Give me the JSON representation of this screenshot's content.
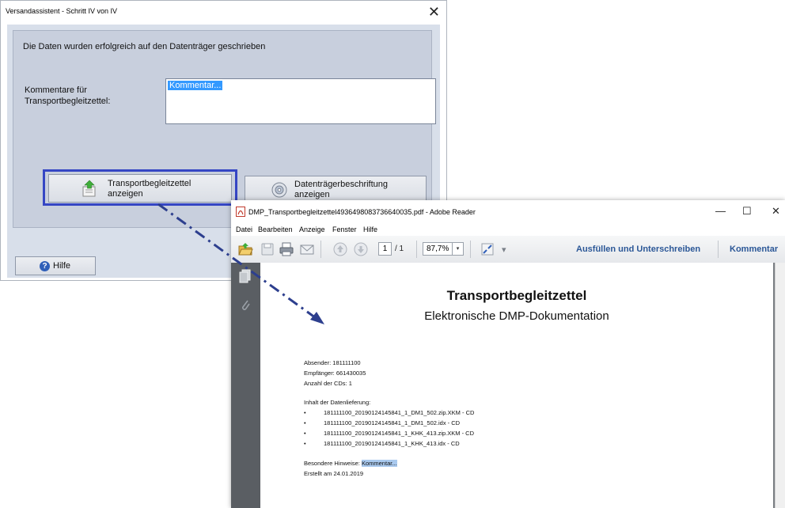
{
  "wizard": {
    "title": "Versandassistent - Schritt IV von IV",
    "close_glyph": "✕",
    "status_text": "Die Daten wurden erfolgreich auf den Datenträger geschrieben",
    "comment_label_line1": "Kommentare für",
    "comment_label_line2": "Transportbegleitzettel:",
    "comment_value": "Kommentar...",
    "btn_transport_line1": "Transportbegleitzettel",
    "btn_transport_line2": "anzeigen",
    "btn_disk_line1": "Datenträgerbeschriftung",
    "btn_disk_line2": "anzeigen",
    "help_label": "Hilfe",
    "help_glyph": "?",
    "highlight_color": "#3546c4"
  },
  "reader": {
    "title": "DMP_Transportbegleitzettel493649808373664003​5.pdf - Adobe Reader",
    "minimize_glyph": "—",
    "maximize_glyph": "☐",
    "close_glyph": "✕",
    "menus": [
      "Datei",
      "Bearbeiten",
      "Anzeige",
      "Fenster",
      "Hilfe"
    ],
    "toolbar": {
      "icons": [
        "open-folder-icon",
        "save-icon",
        "print-icon",
        "email-icon",
        "page-up-icon",
        "page-down-icon",
        "fit-page-icon"
      ],
      "page_current": "1",
      "page_total": "/ 1",
      "zoom": "87,7%",
      "dropdown_glyph": "▾",
      "more_glyph": "▾",
      "fill_sign": "Ausfüllen und Unterschreiben",
      "comment": "Kommentar"
    },
    "document": {
      "title": "Transportbegleitzettel",
      "subtitle": "Elektronische DMP-Dokumentation",
      "sender": "Absender: 181111100",
      "recipient": "Empfänger: 661430035",
      "cd_count": "Anzahl der CDs: 1",
      "contents_heading": "Inhalt der Datenlieferung:",
      "bullet": "•",
      "items": [
        "181111100_20190124145841_1_DM1_502.zip.XKM - CD",
        "181111100_20190124145841_1_DM1_502.idx - CD",
        "181111100_20190124145841_1_KHK_413.zip.XKM - CD",
        "181111100_20190124145841_1_KHK_413.idx - CD"
      ],
      "notes_label": "Besondere Hinweise: ",
      "notes_value": "Kommentar...",
      "created": "Erstellt am 24.01.2019"
    }
  },
  "colors": {
    "arrow": "#2d3f8e",
    "link": "#2b5797",
    "dialog_bg": "#d8dfea",
    "sidebar": "#5a5e63"
  }
}
